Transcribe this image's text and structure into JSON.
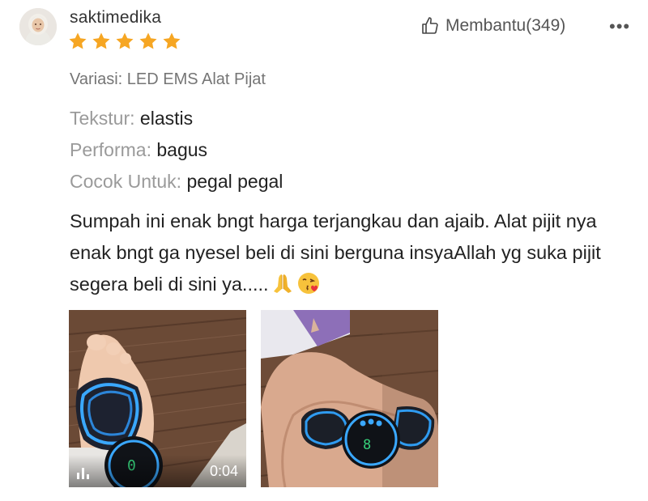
{
  "review": {
    "username": "saktimedika",
    "rating": 5,
    "helpful_label": "Membantu(349)",
    "more_label": "•••",
    "variation": "Variasi: LED EMS Alat Pijat",
    "attributes": [
      {
        "key": "Tekstur:",
        "value": "elastis"
      },
      {
        "key": "Performa:",
        "value": "bagus"
      },
      {
        "key": "Cocok Untuk:",
        "value": "pegal pegal"
      }
    ],
    "text": "Sumpah ini enak bngt harga terjangkau dan ajaib. Alat pijit nya enak bngt ga nyesel beli di sini berguna insyaAllah yg suka pijit segera beli di sini ya.....",
    "emojis": [
      "folded-hands-emoji",
      "face-blowing-kiss-emoji"
    ],
    "media": [
      {
        "type": "video",
        "duration": "0:04"
      },
      {
        "type": "image"
      }
    ]
  },
  "colors": {
    "star": "#f6a623",
    "secondary_text": "#757575",
    "attr_key": "#9a9a9a"
  }
}
